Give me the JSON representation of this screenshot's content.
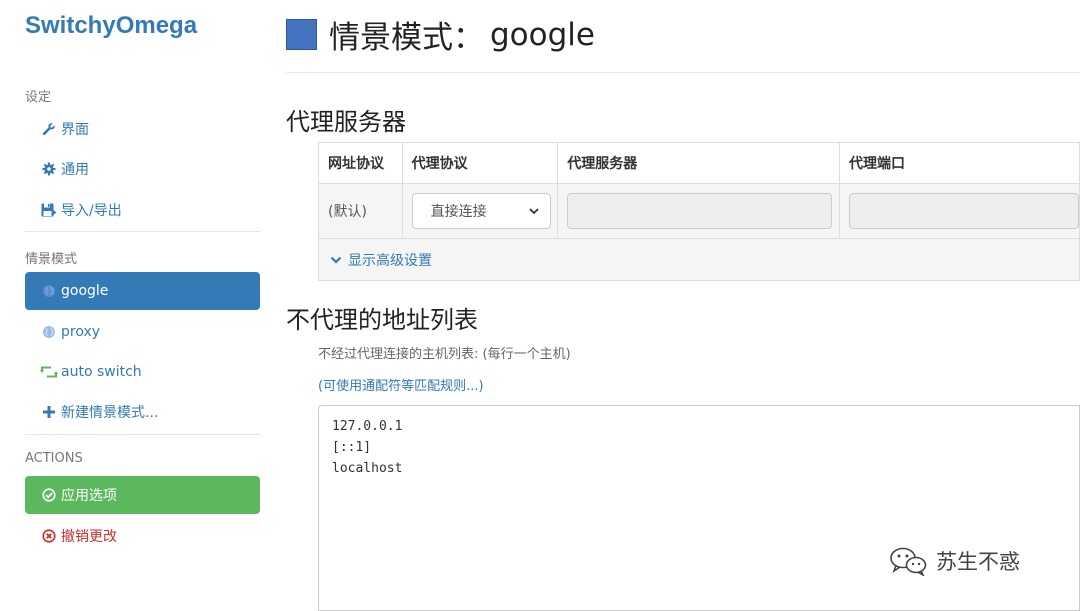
{
  "app": {
    "brand": "SwitchyOmega"
  },
  "sidebar": {
    "settings_header": "设定",
    "settings_items": [
      {
        "label": "界面",
        "icon": "wrench-icon"
      },
      {
        "label": "通用",
        "icon": "gear-icon"
      },
      {
        "label": "导入/导出",
        "icon": "save-icon"
      }
    ],
    "profiles_header": "情景模式",
    "profiles": [
      {
        "label": "google",
        "icon": "globe-icon",
        "active": true
      },
      {
        "label": "proxy",
        "icon": "globe-icon",
        "active": false
      },
      {
        "label": "auto switch",
        "icon": "retweet-icon",
        "active": false
      },
      {
        "label": "新建情景模式...",
        "icon": "plus-icon",
        "active": false
      }
    ],
    "actions_header": "ACTIONS",
    "actions": {
      "apply": {
        "label": "应用选项",
        "icon": "check-circle-icon"
      },
      "discard": {
        "label": "撤销更改",
        "icon": "x-circle-icon"
      }
    }
  },
  "main": {
    "title_prefix": "情景模式：",
    "title_name": "google",
    "proxy_section": {
      "heading": "代理服务器",
      "columns": [
        "网址协议",
        "代理协议",
        "代理服务器",
        "代理端口"
      ],
      "row": {
        "scheme": "(默认)",
        "protocol": "直接连接"
      },
      "advanced_link": "显示高级设置"
    },
    "bypass_section": {
      "heading": "不代理的地址列表",
      "help": "不经过代理连接的主机列表: (每行一个主机)",
      "wildcard_link": "(可使用通配符等匹配规则...)",
      "entries": [
        "127.0.0.1",
        "[::1]",
        "localhost"
      ]
    }
  },
  "watermark": {
    "text": "苏生不惑"
  },
  "colors": {
    "primary": "#337ab7",
    "success": "#5cb85c",
    "danger": "#c9302c",
    "profile_square": "#4673c0"
  }
}
